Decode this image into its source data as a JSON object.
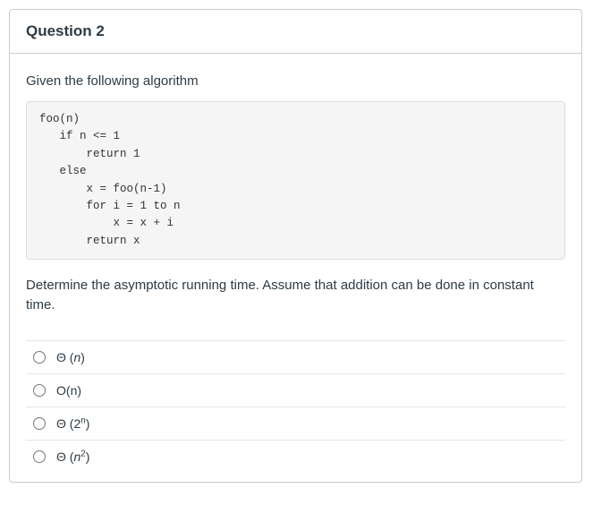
{
  "question": {
    "title": "Question 2",
    "prompt": "Given the following algorithm",
    "code": "foo(n)\n   if n <= 1\n       return 1\n   else\n       x = foo(n-1)\n       for i = 1 to n\n           x = x + i\n       return x",
    "followup": "Determine the asymptotic running time.  Assume that addition can be done in constant time.",
    "options": [
      {
        "theta": "Θ ",
        "open": "(",
        "var": "n",
        "exp": "",
        "close": ")"
      },
      {
        "theta": "",
        "open": "O(",
        "var": "",
        "exp": "",
        "close": "n)"
      },
      {
        "theta": "Θ ",
        "open": "(2",
        "var": "",
        "exp": "n",
        "close": ")"
      },
      {
        "theta": "Θ ",
        "open": "(",
        "var": "n",
        "exp": "2",
        "close": ")"
      }
    ]
  }
}
